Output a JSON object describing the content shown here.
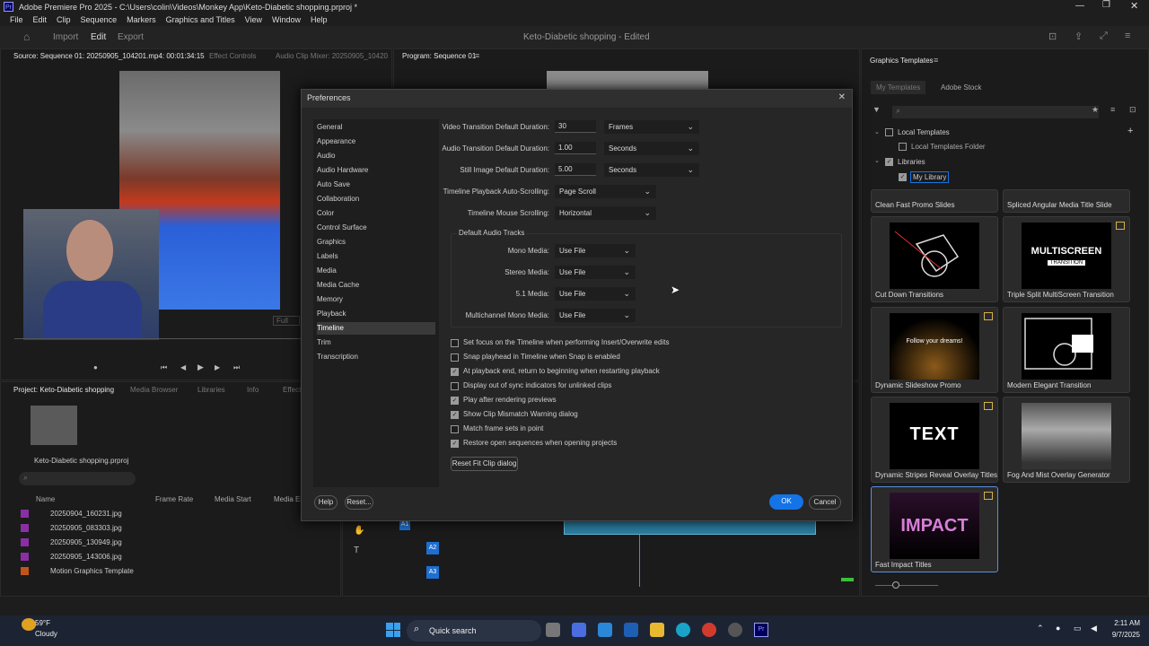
{
  "window": {
    "app_icon": "Pr",
    "title": "Adobe Premiere Pro 2025 - C:\\Users\\colin\\Videos\\Monkey App\\Keto-Diabetic shopping.prproj *"
  },
  "menu": [
    "File",
    "Edit",
    "Clip",
    "Sequence",
    "Markers",
    "Graphics and Titles",
    "View",
    "Window",
    "Help"
  ],
  "toolbar": {
    "import": "Import",
    "edit": "Edit",
    "export": "Export",
    "project_title": "Keto-Diabetic shopping - Edited"
  },
  "source_panel": {
    "tab_source": "Source: Sequence 01: 20250905_104201.mp4: 00:01:34:15",
    "tab_effect_controls": "Effect Controls",
    "tab_audio_mixer": "Audio Clip Mixer: 20250905_10420",
    "fit": "Full"
  },
  "program_panel": {
    "tab": "Program: Sequence 01"
  },
  "project_panel": {
    "tab_project": "Project: Keto-Diabetic shopping",
    "tab_media_browser": "Media Browser",
    "tab_libraries": "Libraries",
    "tab_info": "Info",
    "tab_effects": "Effects",
    "project_file": "Keto-Diabetic shopping.prproj",
    "col_name": "Name",
    "col_frame_rate": "Frame Rate",
    "col_media_start": "Media Start",
    "col_media_end": "Media En",
    "items": [
      "20250904_160231.jpg",
      "20250905_083303.jpg",
      "20250905_130949.jpg",
      "20250905_143006.jpg",
      "Motion Graphics Template"
    ]
  },
  "timeline": {
    "tracks": [
      "A1",
      "A2",
      "A3"
    ]
  },
  "graphics_templates": {
    "title": "Graphics Templates",
    "tab_my": "My Templates",
    "tab_stock": "Adobe Stock",
    "local_templates": "Local Templates",
    "local_templates_folder": "Local Templates Folder",
    "libraries": "Libraries",
    "my_library": "My Library",
    "cards": [
      {
        "name": "Clean Fast Promo Slides"
      },
      {
        "name": "Spliced Angular Media Title Slide"
      },
      {
        "name": "Cut Down Transitions"
      },
      {
        "name": "Triple Split MultiScreen Transition",
        "thumb_text": "MULTISCREEN",
        "thumb_sub": "TRANSITION"
      },
      {
        "name": "Dynamic Slideshow Promo",
        "thumb_text": "Follow your dreams!"
      },
      {
        "name": "Modern Elegant Transition"
      },
      {
        "name": "Dynamic Stripes Reveal Overlay Titles",
        "thumb_text": "TEXT"
      },
      {
        "name": "Fog And Mist Overlay Generator"
      },
      {
        "name": "Fast Impact Titles",
        "thumb_text": "IMPACT"
      }
    ]
  },
  "dialog": {
    "title": "Preferences",
    "categories": [
      "General",
      "Appearance",
      "Audio",
      "Audio Hardware",
      "Auto Save",
      "Collaboration",
      "Color",
      "Control Surface",
      "Graphics",
      "Labels",
      "Media",
      "Media Cache",
      "Memory",
      "Playback",
      "Timeline",
      "Trim",
      "Transcription"
    ],
    "selected_category": "Timeline",
    "fields": {
      "video_transition_label": "Video Transition Default Duration:",
      "video_transition_value": "30",
      "video_transition_unit": "Frames",
      "audio_transition_label": "Audio Transition Default Duration:",
      "audio_transition_value": "1.00",
      "audio_transition_unit": "Seconds",
      "still_image_label": "Still Image Default Duration:",
      "still_image_value": "5.00",
      "still_image_unit": "Seconds",
      "autoscroll_label": "Timeline Playback Auto-Scrolling:",
      "autoscroll_value": "Page Scroll",
      "mouse_scroll_label": "Timeline Mouse Scrolling:",
      "mouse_scroll_value": "Horizontal"
    },
    "audio_tracks": {
      "title": "Default Audio Tracks",
      "rows": [
        {
          "label": "Mono Media:",
          "value": "Use File"
        },
        {
          "label": "Stereo Media:",
          "value": "Use File"
        },
        {
          "label": "5.1 Media:",
          "value": "Use File"
        },
        {
          "label": "Multichannel Mono Media:",
          "value": "Use File"
        }
      ]
    },
    "checkboxes": [
      {
        "label": "Set focus on the Timeline when performing Insert/Overwrite edits",
        "checked": false
      },
      {
        "label": "Snap playhead in Timeline when Snap is enabled",
        "checked": false
      },
      {
        "label": "At playback end, return to beginning when restarting playback",
        "checked": true
      },
      {
        "label": "Display out of sync indicators for unlinked clips",
        "checked": false
      },
      {
        "label": "Play after rendering previews",
        "checked": true
      },
      {
        "label": "Show Clip Mismatch Warning dialog",
        "checked": true
      },
      {
        "label": "Match frame sets in point",
        "checked": false
      },
      {
        "label": "Restore open sequences when opening projects",
        "checked": true
      }
    ],
    "reset_fit_clip": "Reset Fit Clip dialog",
    "help": "Help",
    "reset": "Reset...",
    "ok": "OK",
    "cancel": "Cancel"
  },
  "taskbar": {
    "weather_temp": "59°F",
    "weather_desc": "Cloudy",
    "search": "Quick search",
    "time": "2:11 AM",
    "date": "9/7/2025"
  },
  "colors": {
    "accent": "#1473e6",
    "label_violet": "#8a2ea6",
    "track_blue": "#1e6fd0"
  }
}
